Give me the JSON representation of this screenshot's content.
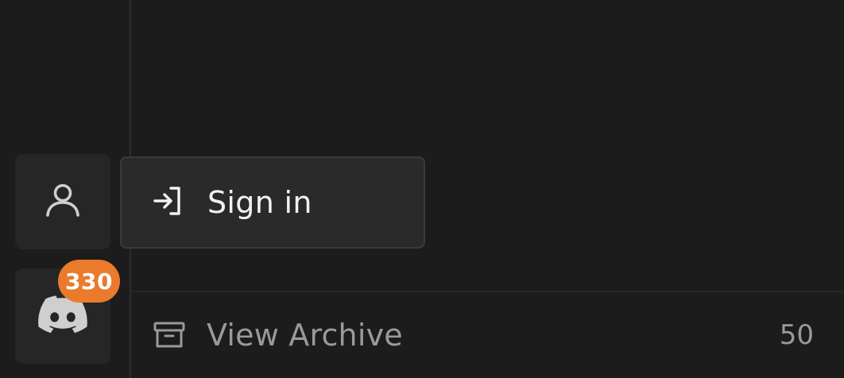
{
  "rail": {
    "account_button": {
      "icon": "user-icon"
    },
    "discord_button": {
      "icon": "discord-icon",
      "badge_count": "330",
      "badge_color": "#ea7a2c"
    }
  },
  "popup": {
    "icon": "sign-in-icon",
    "label": "Sign in"
  },
  "archive": {
    "icon": "archive-icon",
    "label": "View Archive",
    "count": "50"
  },
  "colors": {
    "background": "#1c1c1c",
    "button_bg": "#262626",
    "popup_bg": "#2a2a2a",
    "badge": "#ea7a2c",
    "muted_text": "#9a9a9a"
  }
}
